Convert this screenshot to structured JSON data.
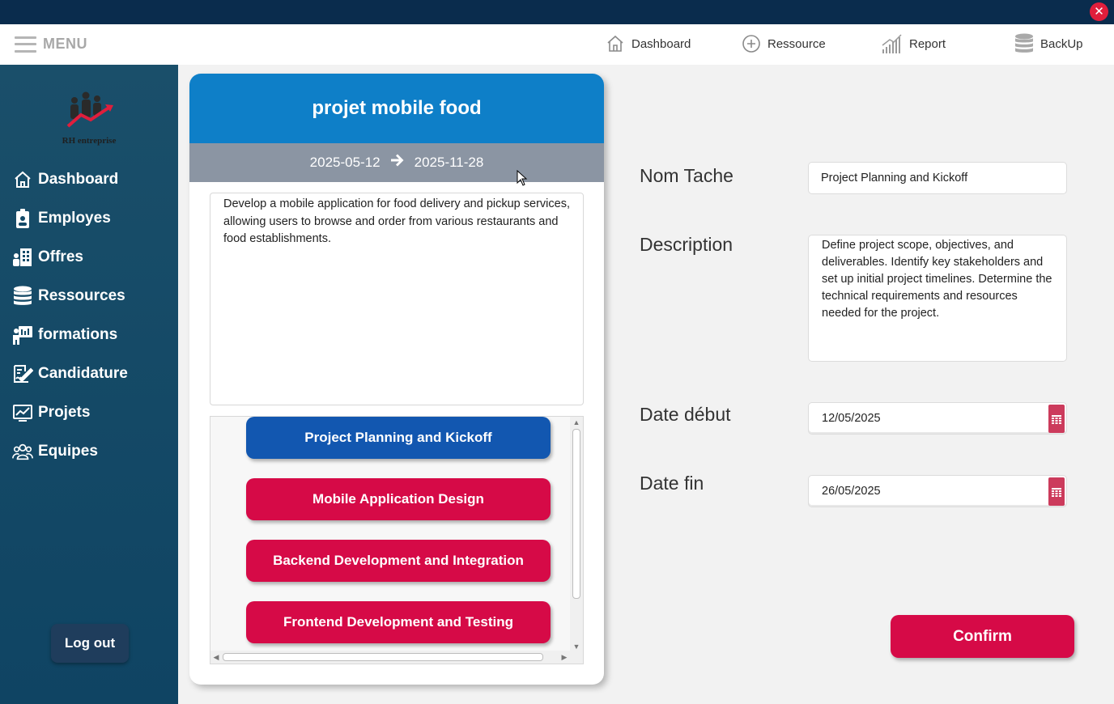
{
  "window": {
    "close_glyph": "✕"
  },
  "topnav": {
    "menu_label": "MENU",
    "items": [
      {
        "label": "Dashboard",
        "icon": "home-icon"
      },
      {
        "label": "Ressource",
        "icon": "plus-circle-icon"
      },
      {
        "label": "Report",
        "icon": "bar-chart-icon"
      },
      {
        "label": "BackUp",
        "icon": "database-icon"
      }
    ]
  },
  "sidebar": {
    "logo_text": "RH entreprise",
    "items": [
      {
        "label": "Dashboard",
        "icon": "home-icon"
      },
      {
        "label": "Employes",
        "icon": "employee-badge-icon"
      },
      {
        "label": "Offres",
        "icon": "building-icon"
      },
      {
        "label": "Ressources",
        "icon": "database-icon"
      },
      {
        "label": "formations",
        "icon": "presentation-icon"
      },
      {
        "label": "Candidature",
        "icon": "signature-icon"
      },
      {
        "label": "Projets",
        "icon": "chart-board-icon"
      },
      {
        "label": "Equipes",
        "icon": "team-icon"
      }
    ],
    "logout_label": "Log out"
  },
  "project": {
    "title": "projet mobile food",
    "start_date": "2025-05-12",
    "end_date": "2025-11-28",
    "description": "Develop a mobile application for food delivery and pickup services, allowing users to browse and order from various restaurants and food establishments.",
    "tasks": [
      {
        "label": "Project Planning and Kickoff",
        "state": "active"
      },
      {
        "label": "Mobile Application Design",
        "state": "normal"
      },
      {
        "label": "Backend Development and Integration",
        "state": "normal"
      },
      {
        "label": "Frontend Development and Testing",
        "state": "normal"
      }
    ]
  },
  "form": {
    "nom_tache_label": "Nom Tache",
    "nom_tache_value": "Project Planning and Kickoff",
    "description_label": "Description",
    "description_value": "Define project scope, objectives, and deliverables. Identify key stakeholders and set up initial project timelines. Determine the technical requirements and resources needed for the project.",
    "date_debut_label": "Date début",
    "date_debut_value": "12/05/2025",
    "date_fin_label": "Date fin",
    "date_fin_value": "26/05/2025",
    "confirm_label": "Confirm"
  },
  "colors": {
    "titlebar": "#0a2c4d",
    "sidebar": "#0f4463",
    "card_header": "#0e7fc8",
    "active_task": "#1257b0",
    "task": "#d60a47",
    "confirm": "#d60a47"
  }
}
